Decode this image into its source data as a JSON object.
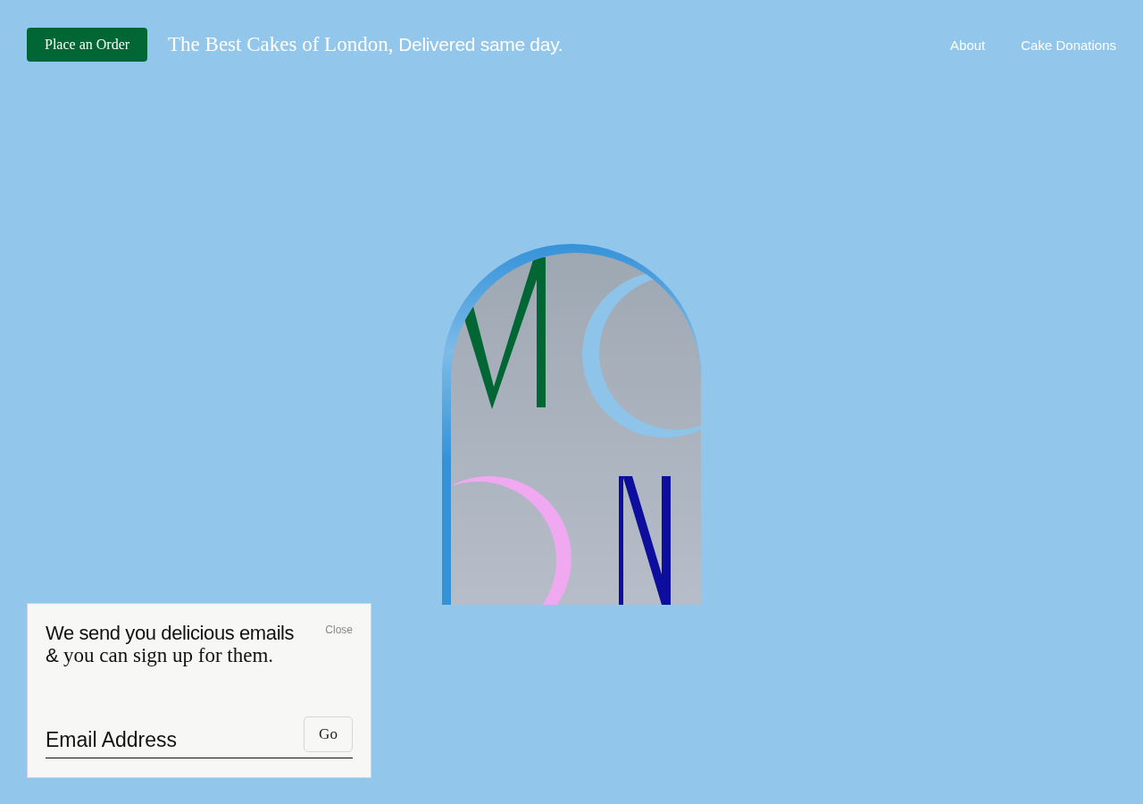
{
  "header": {
    "order_button": "Place an Order",
    "tagline": {
      "serif": "The Best Cakes of London,",
      "sans": "Delivered same day."
    },
    "nav": [
      {
        "label": "About"
      },
      {
        "label": "Cake Donations"
      }
    ]
  },
  "signup": {
    "close": "Close",
    "heading": {
      "lead": "We send you delicious emails &",
      "rest": "you can sign up for them."
    },
    "email": {
      "placeholder": "Email Address"
    },
    "submit": "Go"
  }
}
